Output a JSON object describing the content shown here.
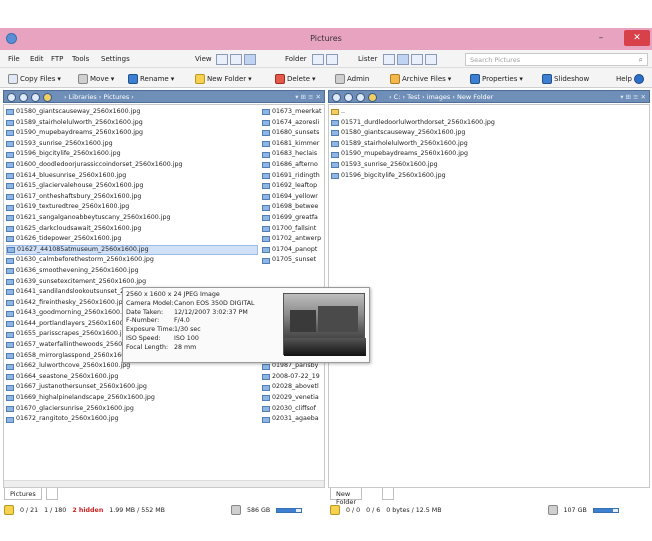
{
  "window": {
    "title": "Pictures",
    "minimize": "–",
    "maximize": "▫",
    "close": "✕"
  },
  "menu": {
    "file": "File",
    "edit": "Edit",
    "ftp": "FTP",
    "tools": "Tools",
    "settings": "Settings",
    "view": "View",
    "folder": "Folder",
    "lister": "Lister"
  },
  "search": {
    "placeholder": "Search Pictures"
  },
  "toolbar": {
    "copy": "Copy Files",
    "move": "Move",
    "rename": "Rename",
    "new_folder": "New Folder",
    "delete": "Delete",
    "admin": "Admin",
    "archive": "Archive Files",
    "properties": "Properties",
    "slideshow": "Slideshow",
    "help": "Help"
  },
  "left": {
    "crumb": "› Libraries › Pictures ›",
    "files": [
      "01580_giantscauseway_2560x1600.jpg",
      "01589_stairholelulworth_2560x1600.jpg",
      "01590_mupebaydreams_2560x1600.jpg",
      "01593_sunrise_2560x1600.jpg",
      "01596_bigcitylife_2560x1600.jpg",
      "01600_doodledoorjurassiccoindorset_2560x1600.jpg",
      "01614_bluesunrise_2560x1600.jpg",
      "01615_glaciervalehouse_2560x1600.jpg",
      "01617_ontheshaftsbury_2560x1600.jpg",
      "01619_texturedtree_2560x1600.jpg",
      "01621_sangalganoabbeytuscany_2560x1600.jpg",
      "01625_darkcloudsawait_2560x1600.jpg",
      "01626_tidepower_2560x1600.jpg",
      "01627_441085atmuseum_2560x1600.jpg",
      "01630_calmbeforethestorm_2560x1600.jpg",
      "01636_smoothevening_2560x1600.jpg",
      "01639_sunsetexcitement_2560x1600.jpg",
      "01641_sandilandslookoutsunset_2560x1600.jpg",
      "01642_fireinthesky_2560x1600.jpg",
      "01643_goodmorning_2560x1600.jpg",
      "01644_portlandlayers_2560x1600.jpg",
      "01655_parisscrapes_2560x1600.jpg",
      "01657_waterfallinthewoods_2560x1600.jpg",
      "01658_mirrorglasspond_2560x1600.jpg",
      "01662_lulworthcove_2560x1600.jpg",
      "01664_seastone_2560x1600.jpg",
      "01667_justanothersunset_2560x1600.jpg",
      "01669_highalpinelandscape_2560x1600.jpg",
      "01670_glaciersunrise_2560x1600.jpg",
      "01672_rangitoto_2560x1600.jpg"
    ],
    "files2": [
      "01673_meerkat",
      "01674_azoresli",
      "01680_sunsets",
      "01681_kimmer",
      "01683_heclais",
      "01686_afterno",
      "01691_ridingth",
      "01692_leaftop",
      "01694_yellowr",
      "01698_betwee",
      "01699_greatfa",
      "01700_fallsint",
      "01702_antwerp",
      "01704_panopt",
      "01705_sunset",
      "",
      "",
      "",
      "",
      "",
      "",
      "01897_colorsd",
      "01928_tuscany",
      "01986_golden",
      "01987_parisby",
      "2008-07-22_19",
      "02028_abovetl",
      "02029_venetia",
      "02030_cliffsof",
      "02031_agaeba"
    ],
    "tab": "Pictures",
    "status": {
      "sel": "0 / 21",
      "dirs": "1 / 180",
      "hidden": "2 hidden",
      "size": "1.99 MB / 552 MB",
      "free": "586 GB"
    }
  },
  "right": {
    "crumb": "› C: › Test › images › New Folder",
    "files": [
      "..",
      "01571_durdledoorlulworthdorset_2560x1600.jpg",
      "01580_giantscauseway_2560x1600.jpg",
      "01589_stairholelulworth_2560x1600.jpg",
      "01590_mupebaydreams_2560x1600.jpg",
      "01593_sunrise_2560x1600.jpg",
      "01596_bigcitylife_2560x1600.jpg"
    ],
    "tab": "New Folder",
    "status": {
      "sel": "0 / 0",
      "dirs": "0 / 6",
      "size": "0 bytes / 12.5 MB",
      "free": "107 GB"
    }
  },
  "tooltip": {
    "dims": "2560 x 1600 x 24 JPEG Image",
    "labels": [
      "Camera Model:",
      "Date Taken:",
      "F-Number:",
      "Exposure Time:",
      "ISO Speed:",
      "Focal Length:"
    ],
    "values": [
      "Canon EOS 350D DIGITAL",
      "12/12/2007 3:02:37 PM",
      "F/4.0",
      "1/30 sec",
      "ISO 100",
      "28 mm"
    ]
  }
}
